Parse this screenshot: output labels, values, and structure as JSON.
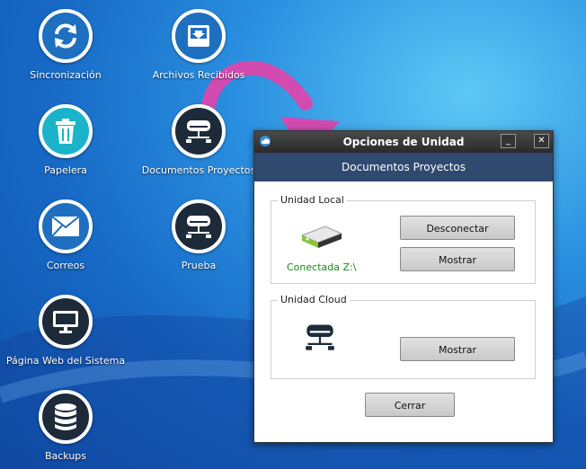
{
  "desktop": {
    "icons": [
      {
        "label": "Sincronización",
        "icon": "sync-icon"
      },
      {
        "label": "Archivos Recibidos",
        "icon": "inbox-icon"
      },
      {
        "label": "Papelera",
        "icon": "trash-icon"
      },
      {
        "label": "Documentos Proyectos",
        "icon": "network-drive-icon"
      },
      {
        "label": "Correos",
        "icon": "mail-icon"
      },
      {
        "label": "Prueba",
        "icon": "network-drive-icon"
      },
      {
        "label": "Página Web del Sistema",
        "icon": "monitor-icon"
      },
      {
        "label": "Backups",
        "icon": "database-icon"
      }
    ]
  },
  "dialog": {
    "title": "Opciones de Unidad",
    "header": "Documentos Proyectos",
    "local": {
      "title": "Unidad Local",
      "status": "Conectada Z:\\",
      "disconnect_label": "Desconectar",
      "show_label": "Mostrar"
    },
    "cloud": {
      "title": "Unidad Cloud",
      "show_label": "Mostrar"
    },
    "close_label": "Cerrar",
    "minimize_glyph": "_",
    "close_glyph": "✕"
  },
  "colors": {
    "accent_arrow": "#d24bb0",
    "header_bg": "#2f4a6e",
    "status_green": "#1a8a1a"
  }
}
